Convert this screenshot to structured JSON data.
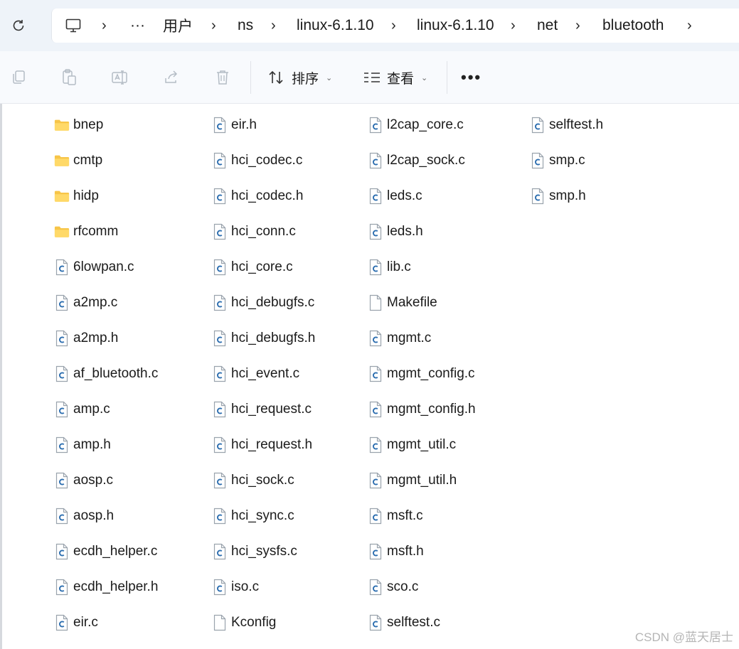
{
  "address_bar": {
    "breadcrumbs": [
      "用户",
      "ns",
      "linux-6.1.10",
      "linux-6.1.10",
      "net",
      "bluetooth"
    ],
    "overflow": "···"
  },
  "toolbar": {
    "sort_label": "排序",
    "view_label": "查看",
    "more_label": "•••"
  },
  "files": {
    "columns": [
      [
        {
          "name": "bnep",
          "type": "folder"
        },
        {
          "name": "cmtp",
          "type": "folder"
        },
        {
          "name": "hidp",
          "type": "folder"
        },
        {
          "name": "rfcomm",
          "type": "folder"
        },
        {
          "name": "6lowpan.c",
          "type": "c"
        },
        {
          "name": "a2mp.c",
          "type": "c"
        },
        {
          "name": "a2mp.h",
          "type": "c"
        },
        {
          "name": "af_bluetooth.c",
          "type": "c"
        },
        {
          "name": "amp.c",
          "type": "c"
        },
        {
          "name": "amp.h",
          "type": "c"
        },
        {
          "name": "aosp.c",
          "type": "c"
        },
        {
          "name": "aosp.h",
          "type": "c"
        },
        {
          "name": "ecdh_helper.c",
          "type": "c"
        },
        {
          "name": "ecdh_helper.h",
          "type": "c"
        },
        {
          "name": "eir.c",
          "type": "c"
        }
      ],
      [
        {
          "name": "eir.h",
          "type": "c"
        },
        {
          "name": "hci_codec.c",
          "type": "c"
        },
        {
          "name": "hci_codec.h",
          "type": "c"
        },
        {
          "name": "hci_conn.c",
          "type": "c"
        },
        {
          "name": "hci_core.c",
          "type": "c"
        },
        {
          "name": "hci_debugfs.c",
          "type": "c"
        },
        {
          "name": "hci_debugfs.h",
          "type": "c"
        },
        {
          "name": "hci_event.c",
          "type": "c"
        },
        {
          "name": "hci_request.c",
          "type": "c"
        },
        {
          "name": "hci_request.h",
          "type": "c"
        },
        {
          "name": "hci_sock.c",
          "type": "c"
        },
        {
          "name": "hci_sync.c",
          "type": "c"
        },
        {
          "name": "hci_sysfs.c",
          "type": "c"
        },
        {
          "name": "iso.c",
          "type": "c"
        },
        {
          "name": "Kconfig",
          "type": "plain"
        }
      ],
      [
        {
          "name": "l2cap_core.c",
          "type": "c"
        },
        {
          "name": "l2cap_sock.c",
          "type": "c"
        },
        {
          "name": "leds.c",
          "type": "c"
        },
        {
          "name": "leds.h",
          "type": "c"
        },
        {
          "name": "lib.c",
          "type": "c"
        },
        {
          "name": "Makefile",
          "type": "plain"
        },
        {
          "name": "mgmt.c",
          "type": "c"
        },
        {
          "name": "mgmt_config.c",
          "type": "c"
        },
        {
          "name": "mgmt_config.h",
          "type": "c"
        },
        {
          "name": "mgmt_util.c",
          "type": "c"
        },
        {
          "name": "mgmt_util.h",
          "type": "c"
        },
        {
          "name": "msft.c",
          "type": "c"
        },
        {
          "name": "msft.h",
          "type": "c"
        },
        {
          "name": "sco.c",
          "type": "c"
        },
        {
          "name": "selftest.c",
          "type": "c"
        }
      ],
      [
        {
          "name": "selftest.h",
          "type": "c"
        },
        {
          "name": "smp.c",
          "type": "c"
        },
        {
          "name": "smp.h",
          "type": "c"
        }
      ]
    ]
  },
  "watermark": "CSDN @蓝天居士",
  "colors": {
    "addrbar_bg": "#eef3f9",
    "folder_yellow": "#f7c548",
    "c_file_blue": "#2e6fb0",
    "icon_gray": "#9aa3ad"
  }
}
